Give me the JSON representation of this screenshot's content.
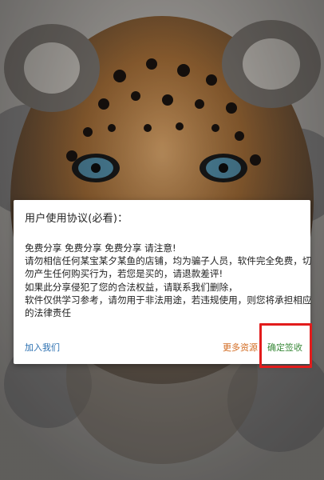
{
  "dialog": {
    "title": "用户使用协议(必看)：",
    "body_lines": [
      "免费分享 免费分享 免费分享 请注意!",
      "请勿相信任何某宝某夕某鱼的店铺，均为骗子人员，软件完全免费，切",
      "勿产生任何购买行为，若您是买的，请退款差评!",
      "如果此分享侵犯了您的合法权益，请联系我们删除，",
      "软件仅供学习参考，请勿用于非法用途，若违规使用，则您将承担相应",
      "的法律责任"
    ],
    "actions": {
      "join": "加入我们",
      "more": "更多资源",
      "agree": "确定签收"
    }
  },
  "colors": {
    "join": "#2a6fb0",
    "more": "#d2691e",
    "agree": "#3a8a3a",
    "highlight": "#e21c1c"
  }
}
